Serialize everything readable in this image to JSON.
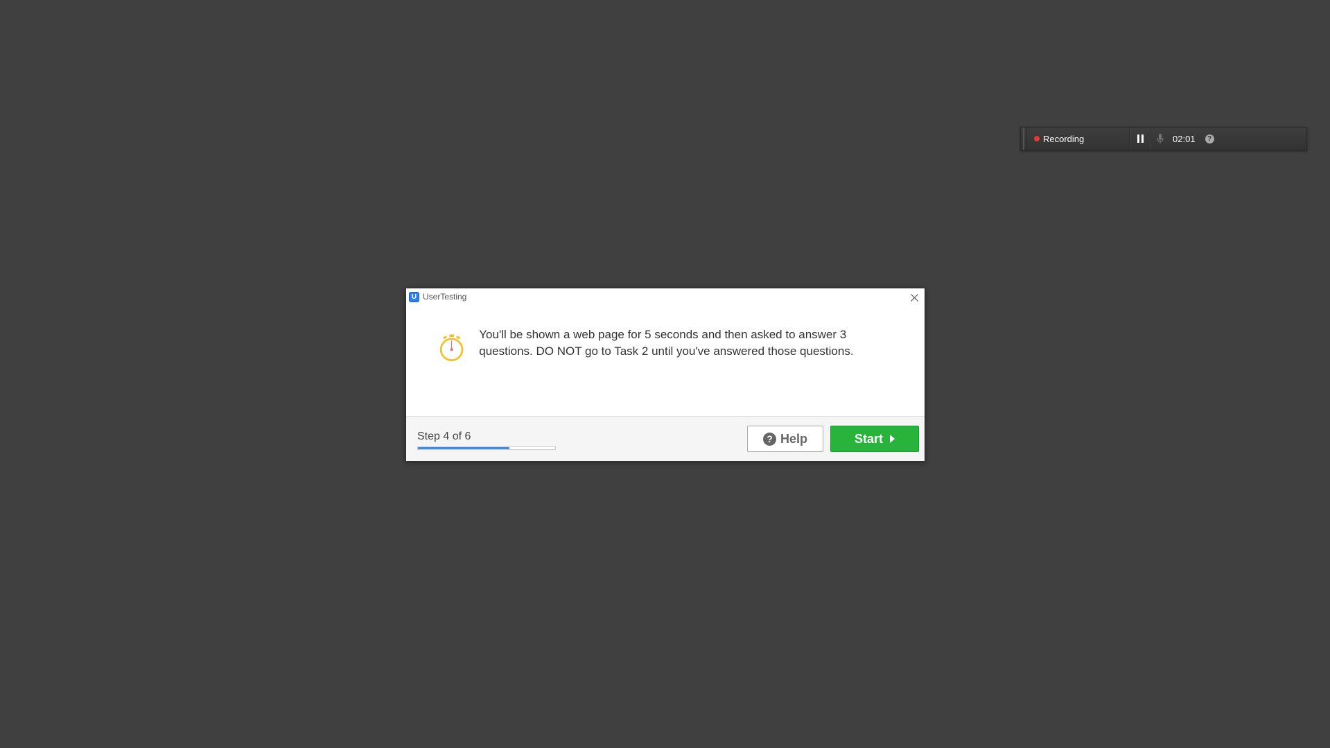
{
  "recorder": {
    "status_label": "Recording",
    "elapsed_time": "02:01",
    "help_glyph": "?"
  },
  "dialog": {
    "app_title": "UserTesting",
    "app_icon_letter": "U",
    "message": "You'll be shown a web page for 5 seconds and then asked to answer 3 questions. DO NOT go to Task 2 until you've answered those questions.",
    "step_label": "Step 4 of 6",
    "progress": 0.667,
    "help_label": "Help",
    "help_glyph": "?",
    "start_label": "Start"
  },
  "colors": {
    "background": "#404040",
    "accent_blue": "#3b8ee6",
    "start_green": "#28b43c",
    "timer_yellow": "#f2c131",
    "recording_red": "#e53935"
  },
  "icons": [
    "stopwatch-icon",
    "close-icon",
    "help-icon",
    "play-icon",
    "microphone-icon",
    "pause-icon",
    "app-logo-icon"
  ]
}
